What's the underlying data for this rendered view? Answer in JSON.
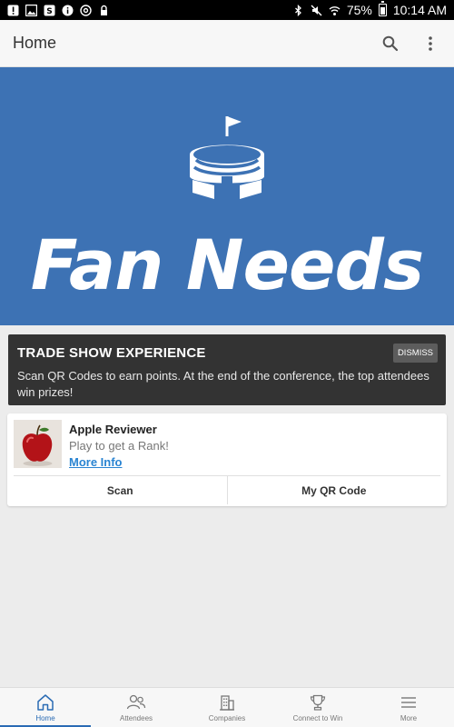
{
  "status_bar": {
    "battery_percent": "75%",
    "time": "10:14 AM",
    "icons_left": [
      "alert-icon",
      "image-icon",
      "message-icon",
      "info-icon",
      "at-icon",
      "lock-icon"
    ],
    "icons_right": [
      "bluetooth-icon",
      "mute-icon",
      "wifi-icon",
      "battery-icon"
    ]
  },
  "app_bar": {
    "title": "Home",
    "actions": [
      "search-icon",
      "more-vert-icon"
    ]
  },
  "banner": {
    "logo_icon": "stadium-icon",
    "brand_text": "Fan Needs",
    "background_color": "#3d72b4"
  },
  "trade_card": {
    "title": "TRADE SHOW EXPERIENCE",
    "dismiss_label": "DISMISS",
    "body": "Scan QR Codes to earn points. At the end of the conference, the top attendees win prizes!"
  },
  "game_card": {
    "thumb_icon": "apple-icon",
    "title": "Apple Reviewer",
    "subtitle": "Play to get a Rank!",
    "more_info_label": "More Info",
    "scan_label": "Scan",
    "qr_label": "My QR Code"
  },
  "bottom_nav": {
    "items": [
      {
        "label": "Home",
        "icon": "home-icon",
        "active": true
      },
      {
        "label": "Attendees",
        "icon": "people-icon",
        "active": false
      },
      {
        "label": "Companies",
        "icon": "building-icon",
        "active": false
      },
      {
        "label": "Connect to Win",
        "icon": "trophy-icon",
        "active": false
      },
      {
        "label": "More",
        "icon": "menu-icon",
        "active": false
      }
    ]
  },
  "colors": {
    "accent": "#2a6bb4",
    "link": "#2a84d2",
    "dark_card": "#333333"
  }
}
